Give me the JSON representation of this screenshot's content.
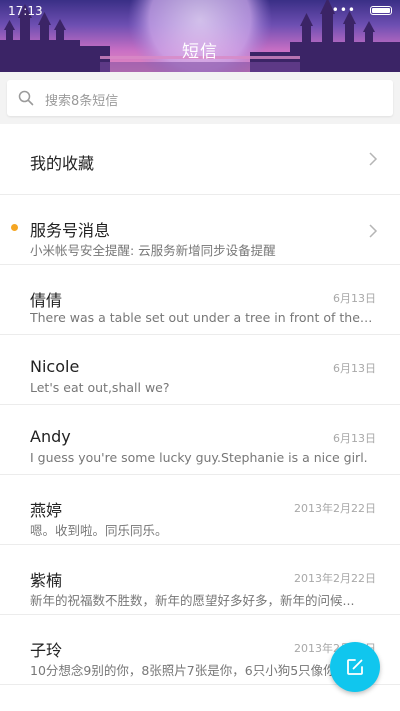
{
  "status_bar": {
    "time": "17:13",
    "signal": "•••"
  },
  "header": {
    "title": "短信"
  },
  "search": {
    "placeholder": "搜索8条短信"
  },
  "favorites": {
    "label": "我的收藏"
  },
  "service": {
    "title": "服务号消息",
    "preview": "小米帐号安全提醒: 云服务新增同步设备提醒"
  },
  "conversations": [
    {
      "name": "倩倩",
      "date": "6月13日",
      "preview": "There was a table set out under a tree in front of the ho..."
    },
    {
      "name": "Nicole",
      "date": "6月13日",
      "preview": "Let's eat out,shall we?"
    },
    {
      "name": "Andy",
      "date": "6月13日",
      "preview": "I guess you're some lucky guy.Stephanie is a nice girl."
    },
    {
      "name": "燕婷",
      "date": "2013年2月22日",
      "preview": "嗯。收到啦。同乐同乐。"
    },
    {
      "name": "紫楠",
      "date": "2013年2月22日",
      "preview": "新年的祝福数不胜数，新年的愿望好多好多，新年的问候..."
    },
    {
      "name": "子玲",
      "date": "2013年2月22日",
      "preview": "10分想念9别的你，8张照片7张是你，6只小狗5只像你..."
    }
  ],
  "colors": {
    "accent": "#10c6ee",
    "unread": "#f5a623"
  },
  "icons": {
    "search": "search-icon",
    "chevron": "chevron-right-icon",
    "compose": "compose-icon"
  }
}
